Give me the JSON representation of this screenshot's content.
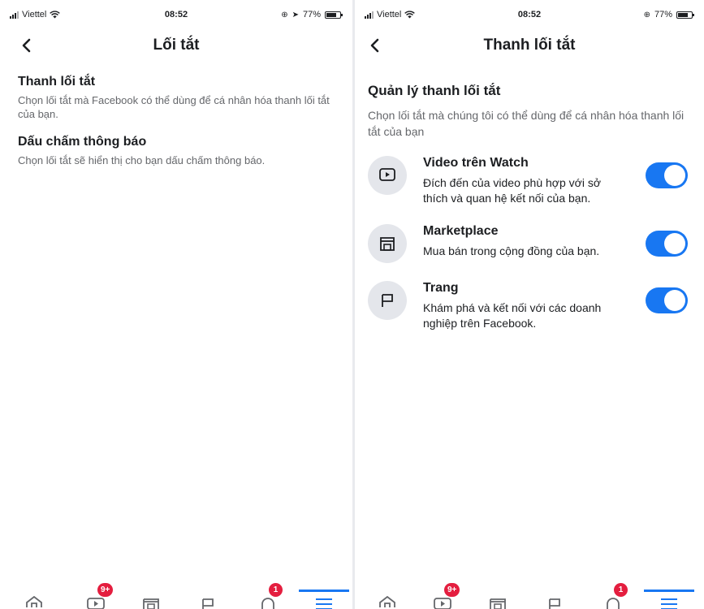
{
  "status_bar": {
    "carrier": "Viettel",
    "time": "08:52",
    "battery_left": "77%",
    "battery_right": "77%"
  },
  "left_screen": {
    "title": "Lối tắt",
    "sections": [
      {
        "title": "Thanh lối tắt",
        "description": "Chọn lối tắt mà Facebook có thể dùng để cá nhân hóa thanh lối tắt của bạn."
      },
      {
        "title": "Dấu chấm thông báo",
        "description": "Chọn lối tắt sẽ hiển thị cho bạn dấu chấm thông báo."
      }
    ]
  },
  "right_screen": {
    "title": "Thanh lối tắt",
    "heading": "Quản lý thanh lối tắt",
    "description": "Chọn lối tắt mà chúng tôi có thể dùng để cá nhân hóa thanh lối tắt của bạn",
    "items": [
      {
        "icon": "video-icon",
        "title": "Video trên Watch",
        "description": "Đích đến của video phù hợp với sở thích và quan hệ kết nối của bạn.",
        "enabled": true
      },
      {
        "icon": "marketplace-icon",
        "title": "Marketplace",
        "description": "Mua bán trong cộng đồng của bạn.",
        "enabled": true
      },
      {
        "icon": "flag-icon",
        "title": "Trang",
        "description": "Khám phá và kết nối với các doanh nghiệp trên Facebook.",
        "enabled": true
      }
    ]
  },
  "tab_bar": {
    "video_badge": "9+",
    "notification_badge": "1",
    "active_tab": "menu"
  },
  "colors": {
    "accent": "#1877f2",
    "badge": "#e41e3f",
    "secondary_text": "#65676b"
  }
}
